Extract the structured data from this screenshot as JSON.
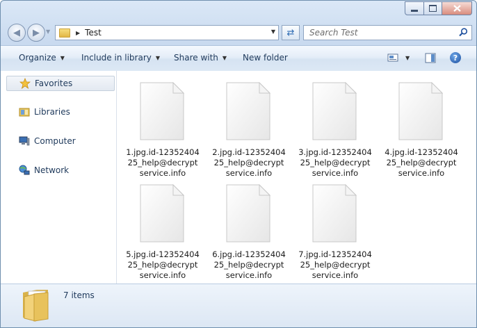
{
  "address": {
    "path": "Test"
  },
  "search": {
    "placeholder": "Search Test"
  },
  "toolbar": {
    "organize": "Organize",
    "include_in_library": "Include in library",
    "share_with": "Share with",
    "new_folder": "New folder"
  },
  "nav": {
    "items": [
      {
        "label": "Favorites",
        "icon": "star-icon",
        "selected": true
      },
      {
        "label": "Libraries",
        "icon": "libraries-icon"
      },
      {
        "label": "Computer",
        "icon": "computer-icon"
      },
      {
        "label": "Network",
        "icon": "network-icon"
      }
    ]
  },
  "files": [
    {
      "line1": "1.jpg.id-12352404",
      "line2": "25_help@decrypt",
      "line3": "service.info"
    },
    {
      "line1": "2.jpg.id-12352404",
      "line2": "25_help@decrypt",
      "line3": "service.info"
    },
    {
      "line1": "3.jpg.id-12352404",
      "line2": "25_help@decrypt",
      "line3": "service.info"
    },
    {
      "line1": "4.jpg.id-12352404",
      "line2": "25_help@decrypt",
      "line3": "service.info"
    },
    {
      "line1": "5.jpg.id-12352404",
      "line2": "25_help@decrypt",
      "line3": "service.info"
    },
    {
      "line1": "6.jpg.id-12352404",
      "line2": "25_help@decrypt",
      "line3": "service.info"
    },
    {
      "line1": "7.jpg.id-12352404",
      "line2": "25_help@decrypt",
      "line3": "service.info"
    }
  ],
  "details": {
    "item_count": "7 items"
  }
}
